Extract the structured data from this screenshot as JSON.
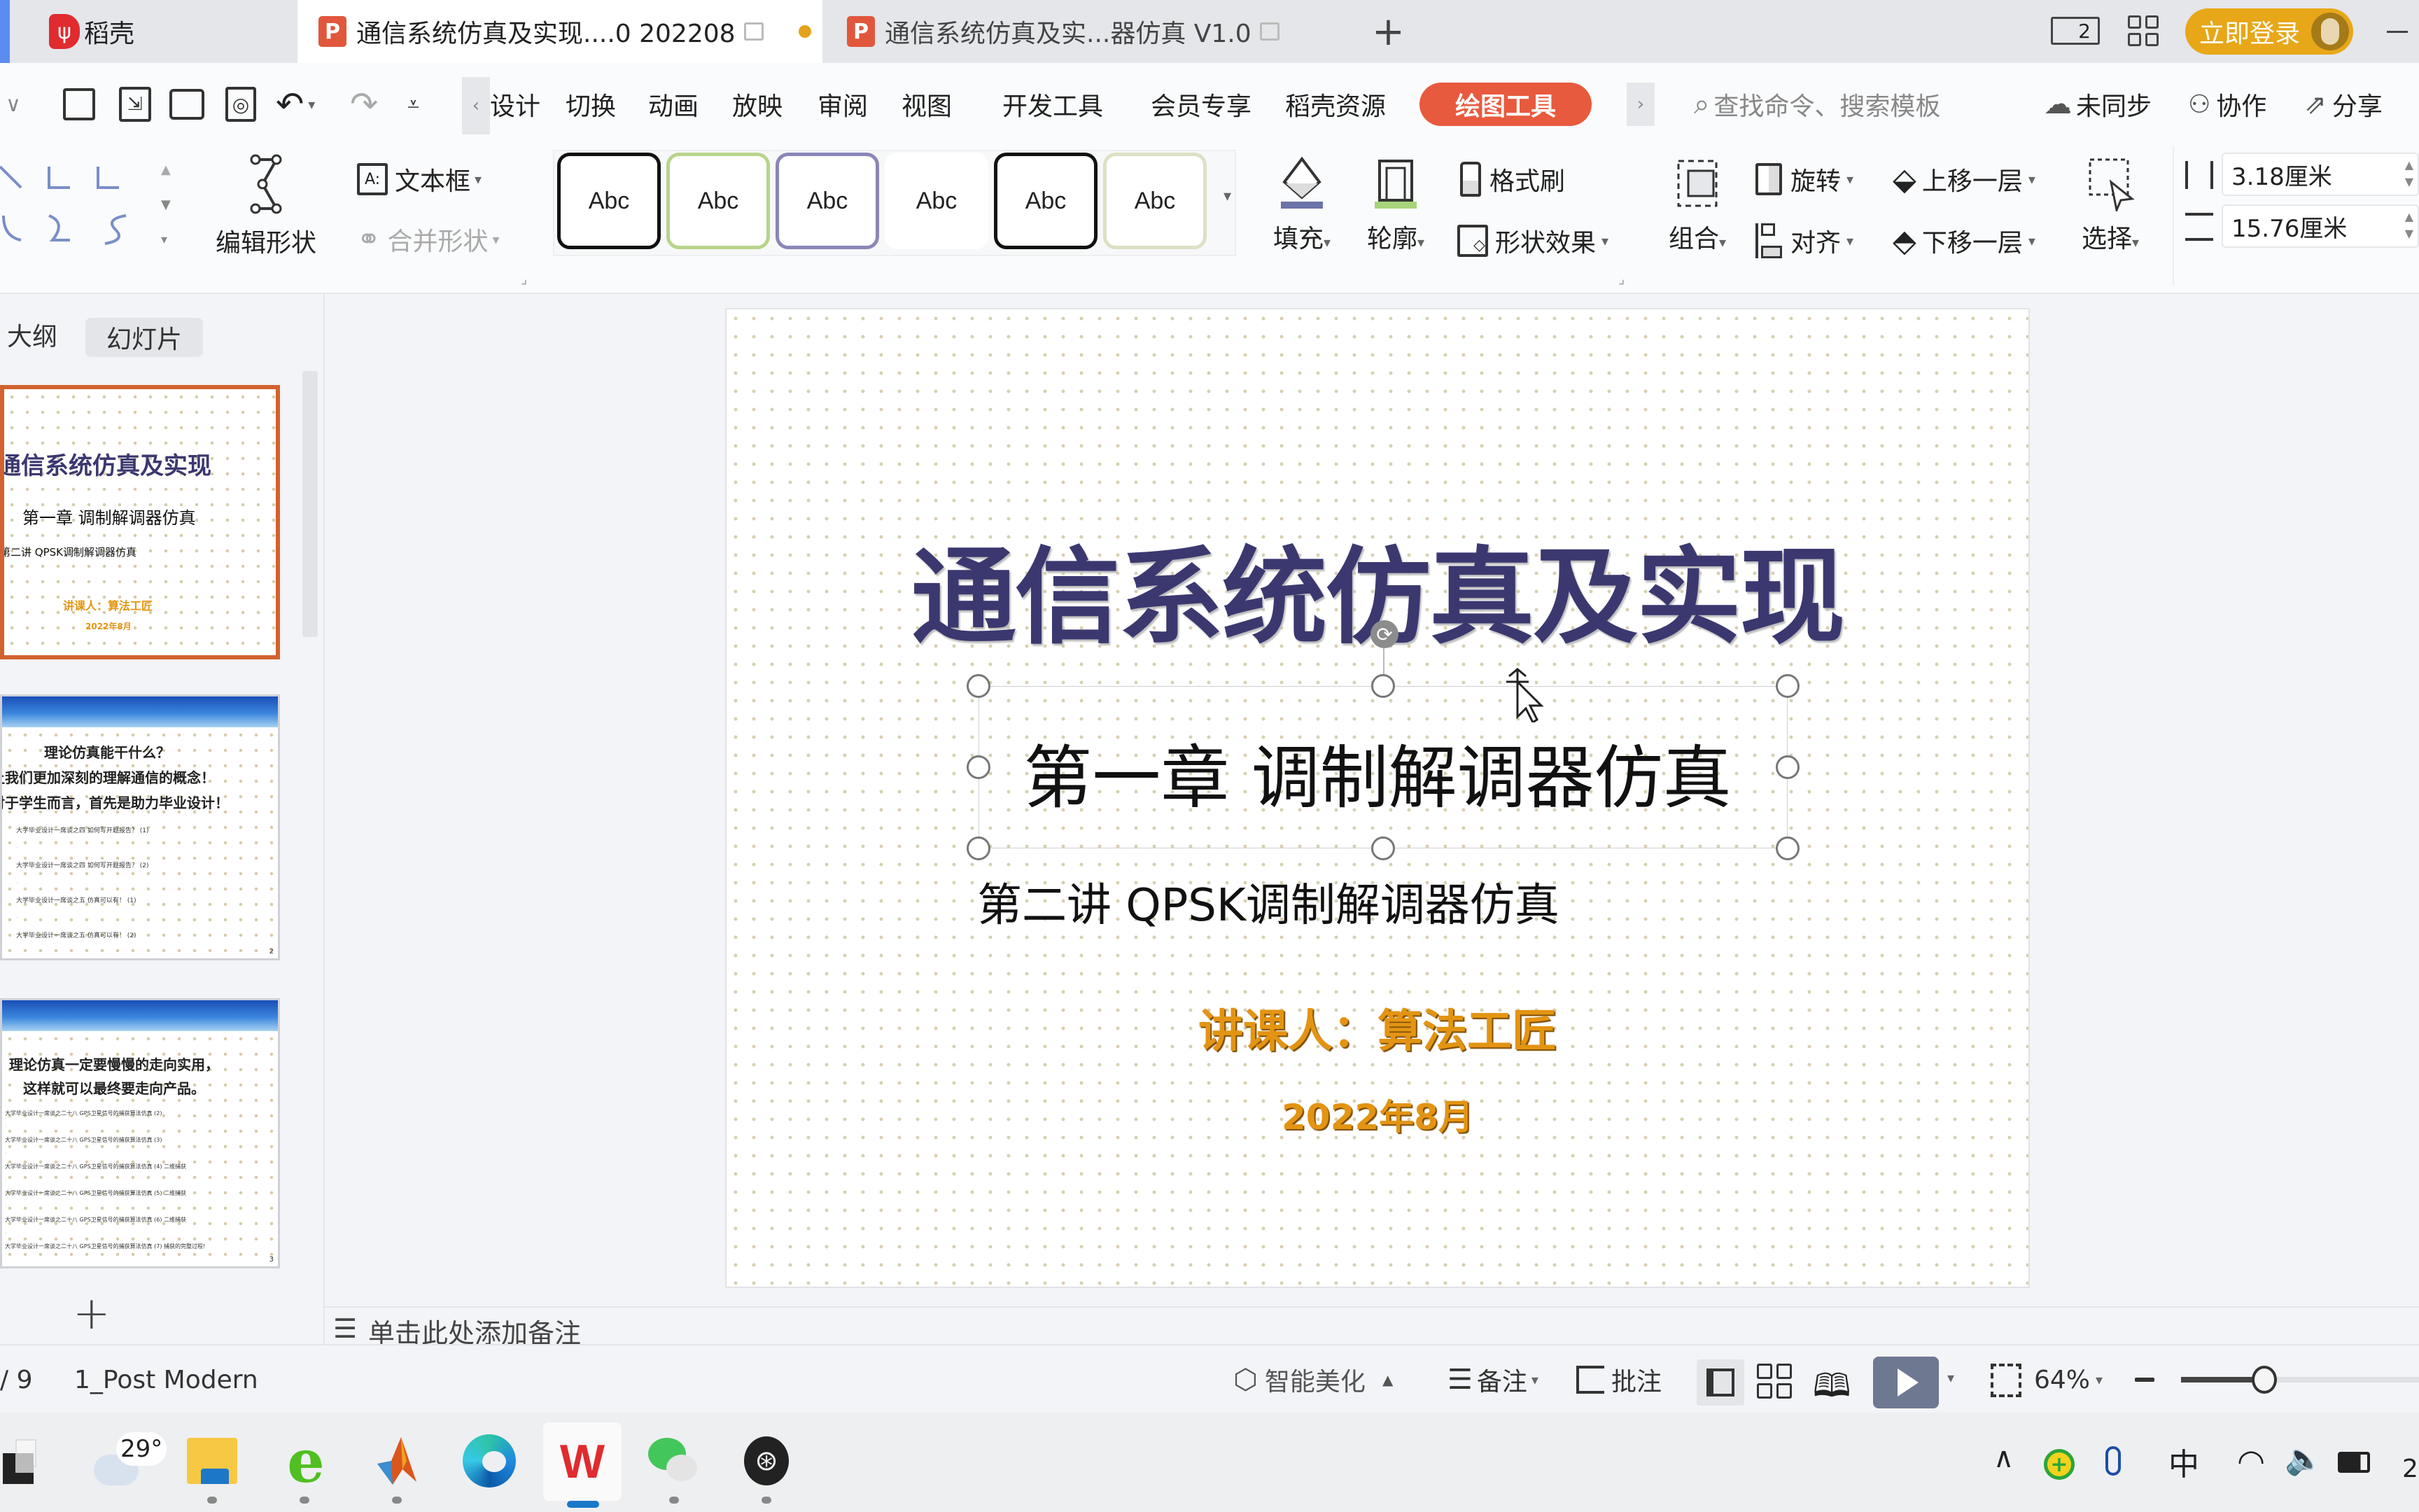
{
  "titlebar": {
    "tabs": [
      {
        "label": "稻壳",
        "icon": "daoke-logo-icon"
      },
      {
        "label": "通信系统仿真及实现....0 202208",
        "icon": "wps-presentation-icon",
        "active": true,
        "modified": true
      },
      {
        "label": "通信系统仿真及实...器仿真 V1.0",
        "icon": "wps-presentation-icon"
      }
    ],
    "new_tab": "+",
    "page_count_badge": "2",
    "login_button": "立即登录"
  },
  "menu": {
    "tabs": [
      "设计",
      "切换",
      "动画",
      "放映",
      "审阅",
      "视图",
      "开发工具",
      "会员专享",
      "稻壳资源"
    ],
    "active_tab": "绘图工具",
    "search_placeholder": "查找命令、搜索模板",
    "sync": "未同步",
    "collab": "协作",
    "share": "分享"
  },
  "ribbon": {
    "edit_shape": "编辑形状",
    "textbox": "文本框",
    "merge_shape": "合并形状",
    "style_samples": [
      {
        "label": "Abc",
        "border": "#111111"
      },
      {
        "label": "Abc",
        "border": "#b8d48a"
      },
      {
        "label": "Abc",
        "border": "#8a86b8"
      },
      {
        "label": "Abc",
        "border": "transparent"
      },
      {
        "label": "Abc",
        "border": "#111111"
      },
      {
        "label": "Abc",
        "border": "#dde0c4"
      }
    ],
    "fill": "填充",
    "fill_color": "#6b73a8",
    "outline": "轮廓",
    "outline_color": "#a8d47a",
    "format_painter": "格式刷",
    "shape_effects": "形状效果",
    "group": "组合",
    "rotate": "旋转",
    "align": "对齐",
    "bring_forward": "上移一层",
    "send_backward": "下移一层",
    "select": "选择",
    "height": "3.18厘米",
    "width": "15.76厘米"
  },
  "leftpanel": {
    "tabs": [
      "大纲",
      "幻灯片"
    ],
    "active_tab": "幻灯片",
    "thumbnails": [
      {
        "title": "通信系统仿真及实现",
        "subtitle": "第一章  调制解调器仿真",
        "line3": "第二讲  QPSK调制解调器仿真",
        "author": "讲课人：算法工匠",
        "date": "2022年8月",
        "selected": true
      },
      {
        "heading": "理论仿真能干什么？",
        "lines": [
          "让我们更加深刻的理解通信的概念！",
          "对于学生而言，首先是助力毕业设计！"
        ],
        "links": [
          "大学毕业设计一席谈之四 如何写开题报告？ (1)",
          "大学毕业设计一席谈之四 如何写开题报告？ (2)",
          "大学毕业设计一席谈之五 仿真可以有！ (1)",
          "大学毕业设计一席谈之五 仿真可以有！ (2)"
        ],
        "page_num": "2"
      },
      {
        "lines": [
          "理论仿真一定要慢慢的走向实用，",
          "这样就可以最终要走向产品。"
        ],
        "links": [
          "大学毕业设计一席谈之二十八 GPS卫星信号的捕获算法仿真 (2)",
          "大学毕业设计一席谈之二十八 GPS卫星信号的捕获算法仿真 (3)",
          "大学毕业设计一席谈之二十八 GPS卫星信号的捕获算法仿真 (4) 二维捕获",
          "大学毕业设计一席谈之二十八 GPS卫星信号的捕获算法仿真 (5) 二维捕获",
          "大学毕业设计一席谈之二十八 GPS卫星信号的捕获算法仿真 (6) 二维捕获",
          "大学毕业设计一席谈之二十八 GPS卫星信号的捕获算法仿真 (7) 捕获的完整过程!"
        ],
        "page_num": "3"
      }
    ],
    "add_slide": "+"
  },
  "slide": {
    "title": "通信系统仿真及实现",
    "title_color": "#3b3870",
    "chapter": "第一章  调制解调器仿真",
    "lecture": "第二讲  QPSK调制解调器仿真",
    "author": "讲课人：算法工匠",
    "date": "2022年8月",
    "accent_color": "#e39412"
  },
  "notes": {
    "placeholder": "单击此处添加备注"
  },
  "statusbar": {
    "page": "/ 9",
    "theme": "1_Post Modern",
    "beautify": "智能美化",
    "notes": "备注",
    "comments": "批注",
    "zoom": "64%",
    "zoom_fraction": 0.35
  },
  "taskbar": {
    "weather_temp": "29°",
    "apps": [
      "task-view",
      "file-explorer",
      "360-browser",
      "matlab",
      "edge",
      "wps-office",
      "wechat",
      "obs-studio"
    ],
    "active_app": "wps-office",
    "ime": "中",
    "clock_partial": "2"
  }
}
